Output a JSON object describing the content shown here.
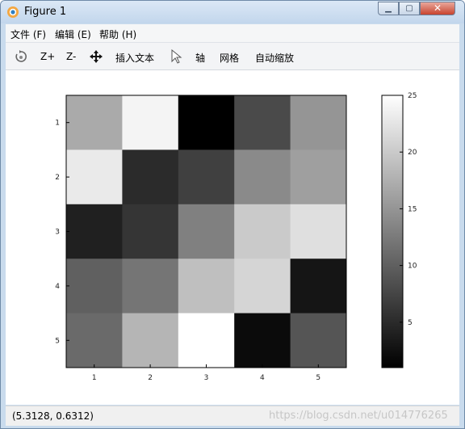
{
  "window": {
    "title": "Figure 1"
  },
  "menu": [
    {
      "label": "文件 (F)"
    },
    {
      "label": "编辑 (E)"
    },
    {
      "label": "帮助 (H)"
    }
  ],
  "toolbar": {
    "zoom_in": "Z+",
    "zoom_out": "Z-",
    "insert_text": "插入文本",
    "axis": "轴",
    "grid": "网格",
    "autoscale": "自动缩放"
  },
  "status": {
    "coords": "(5.3128, 0.6312)"
  },
  "watermark": "https://blog.csdn.net/u014776265",
  "chart_data": {
    "type": "heatmap",
    "colormap": "gray",
    "x_ticks": [
      "1",
      "2",
      "3",
      "4",
      "5"
    ],
    "y_ticks": [
      "1",
      "2",
      "3",
      "4",
      "5"
    ],
    "values": [
      [
        17,
        24,
        1,
        8,
        15
      ],
      [
        23,
        5,
        7,
        14,
        16
      ],
      [
        4,
        6,
        13,
        20,
        22
      ],
      [
        10,
        12,
        19,
        21,
        3
      ],
      [
        11,
        18,
        25,
        2,
        9
      ]
    ],
    "colorbar": {
      "min": 1,
      "max": 25,
      "ticks": [
        "5",
        "10",
        "15",
        "20",
        "25"
      ]
    }
  }
}
